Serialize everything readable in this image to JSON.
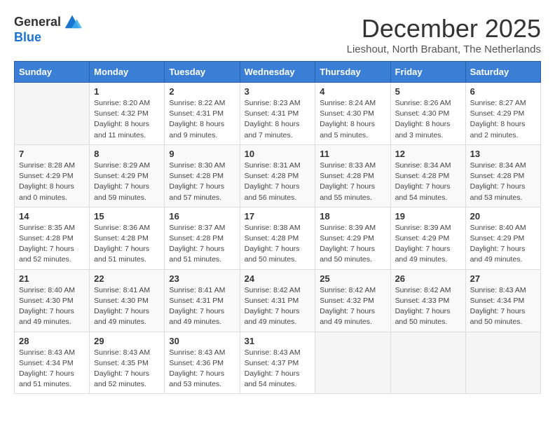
{
  "logo": {
    "general": "General",
    "blue": "Blue"
  },
  "title": "December 2025",
  "subtitle": "Lieshout, North Brabant, The Netherlands",
  "weekdays": [
    "Sunday",
    "Monday",
    "Tuesday",
    "Wednesday",
    "Thursday",
    "Friday",
    "Saturday"
  ],
  "weeks": [
    [
      {
        "day": null,
        "info": null
      },
      {
        "day": "1",
        "info": "Sunrise: 8:20 AM\nSunset: 4:32 PM\nDaylight: 8 hours\nand 11 minutes."
      },
      {
        "day": "2",
        "info": "Sunrise: 8:22 AM\nSunset: 4:31 PM\nDaylight: 8 hours\nand 9 minutes."
      },
      {
        "day": "3",
        "info": "Sunrise: 8:23 AM\nSunset: 4:31 PM\nDaylight: 8 hours\nand 7 minutes."
      },
      {
        "day": "4",
        "info": "Sunrise: 8:24 AM\nSunset: 4:30 PM\nDaylight: 8 hours\nand 5 minutes."
      },
      {
        "day": "5",
        "info": "Sunrise: 8:26 AM\nSunset: 4:30 PM\nDaylight: 8 hours\nand 3 minutes."
      },
      {
        "day": "6",
        "info": "Sunrise: 8:27 AM\nSunset: 4:29 PM\nDaylight: 8 hours\nand 2 minutes."
      }
    ],
    [
      {
        "day": "7",
        "info": "Sunrise: 8:28 AM\nSunset: 4:29 PM\nDaylight: 8 hours\nand 0 minutes."
      },
      {
        "day": "8",
        "info": "Sunrise: 8:29 AM\nSunset: 4:29 PM\nDaylight: 7 hours\nand 59 minutes."
      },
      {
        "day": "9",
        "info": "Sunrise: 8:30 AM\nSunset: 4:28 PM\nDaylight: 7 hours\nand 57 minutes."
      },
      {
        "day": "10",
        "info": "Sunrise: 8:31 AM\nSunset: 4:28 PM\nDaylight: 7 hours\nand 56 minutes."
      },
      {
        "day": "11",
        "info": "Sunrise: 8:33 AM\nSunset: 4:28 PM\nDaylight: 7 hours\nand 55 minutes."
      },
      {
        "day": "12",
        "info": "Sunrise: 8:34 AM\nSunset: 4:28 PM\nDaylight: 7 hours\nand 54 minutes."
      },
      {
        "day": "13",
        "info": "Sunrise: 8:34 AM\nSunset: 4:28 PM\nDaylight: 7 hours\nand 53 minutes."
      }
    ],
    [
      {
        "day": "14",
        "info": "Sunrise: 8:35 AM\nSunset: 4:28 PM\nDaylight: 7 hours\nand 52 minutes."
      },
      {
        "day": "15",
        "info": "Sunrise: 8:36 AM\nSunset: 4:28 PM\nDaylight: 7 hours\nand 51 minutes."
      },
      {
        "day": "16",
        "info": "Sunrise: 8:37 AM\nSunset: 4:28 PM\nDaylight: 7 hours\nand 51 minutes."
      },
      {
        "day": "17",
        "info": "Sunrise: 8:38 AM\nSunset: 4:28 PM\nDaylight: 7 hours\nand 50 minutes."
      },
      {
        "day": "18",
        "info": "Sunrise: 8:39 AM\nSunset: 4:29 PM\nDaylight: 7 hours\nand 50 minutes."
      },
      {
        "day": "19",
        "info": "Sunrise: 8:39 AM\nSunset: 4:29 PM\nDaylight: 7 hours\nand 49 minutes."
      },
      {
        "day": "20",
        "info": "Sunrise: 8:40 AM\nSunset: 4:29 PM\nDaylight: 7 hours\nand 49 minutes."
      }
    ],
    [
      {
        "day": "21",
        "info": "Sunrise: 8:40 AM\nSunset: 4:30 PM\nDaylight: 7 hours\nand 49 minutes."
      },
      {
        "day": "22",
        "info": "Sunrise: 8:41 AM\nSunset: 4:30 PM\nDaylight: 7 hours\nand 49 minutes."
      },
      {
        "day": "23",
        "info": "Sunrise: 8:41 AM\nSunset: 4:31 PM\nDaylight: 7 hours\nand 49 minutes."
      },
      {
        "day": "24",
        "info": "Sunrise: 8:42 AM\nSunset: 4:31 PM\nDaylight: 7 hours\nand 49 minutes."
      },
      {
        "day": "25",
        "info": "Sunrise: 8:42 AM\nSunset: 4:32 PM\nDaylight: 7 hours\nand 49 minutes."
      },
      {
        "day": "26",
        "info": "Sunrise: 8:42 AM\nSunset: 4:33 PM\nDaylight: 7 hours\nand 50 minutes."
      },
      {
        "day": "27",
        "info": "Sunrise: 8:43 AM\nSunset: 4:34 PM\nDaylight: 7 hours\nand 50 minutes."
      }
    ],
    [
      {
        "day": "28",
        "info": "Sunrise: 8:43 AM\nSunset: 4:34 PM\nDaylight: 7 hours\nand 51 minutes."
      },
      {
        "day": "29",
        "info": "Sunrise: 8:43 AM\nSunset: 4:35 PM\nDaylight: 7 hours\nand 52 minutes."
      },
      {
        "day": "30",
        "info": "Sunrise: 8:43 AM\nSunset: 4:36 PM\nDaylight: 7 hours\nand 53 minutes."
      },
      {
        "day": "31",
        "info": "Sunrise: 8:43 AM\nSunset: 4:37 PM\nDaylight: 7 hours\nand 54 minutes."
      },
      {
        "day": null,
        "info": null
      },
      {
        "day": null,
        "info": null
      },
      {
        "day": null,
        "info": null
      }
    ]
  ]
}
